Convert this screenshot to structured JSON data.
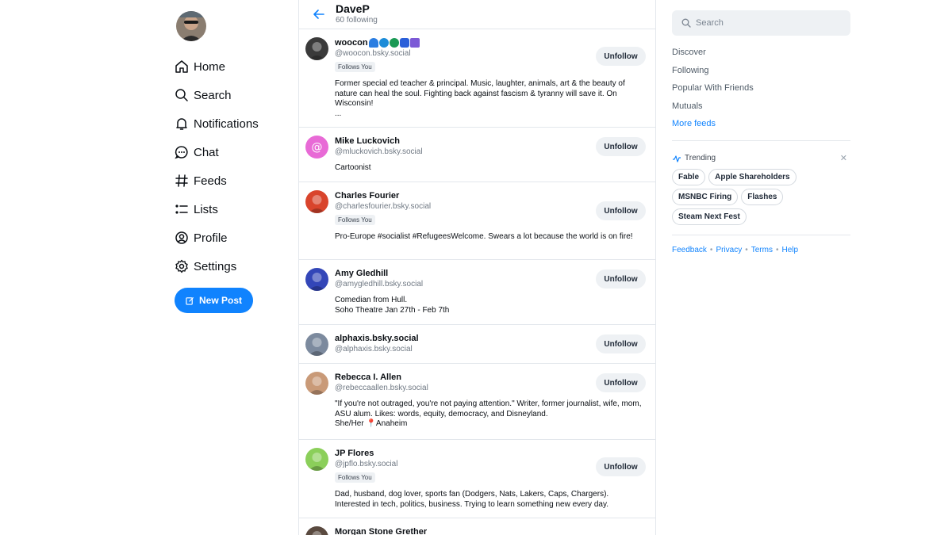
{
  "nav": {
    "items": [
      {
        "label": "Home",
        "icon": "home-icon"
      },
      {
        "label": "Search",
        "icon": "search-icon"
      },
      {
        "label": "Notifications",
        "icon": "bell-icon"
      },
      {
        "label": "Chat",
        "icon": "chat-icon"
      },
      {
        "label": "Feeds",
        "icon": "hash-icon"
      },
      {
        "label": "Lists",
        "icon": "list-icon"
      },
      {
        "label": "Profile",
        "icon": "profile-icon"
      },
      {
        "label": "Settings",
        "icon": "gear-icon"
      }
    ],
    "new_post": "New Post"
  },
  "header": {
    "title": "DaveP",
    "subtitle": "60 following"
  },
  "follow": {
    "unfollow_label": "Unfollow",
    "follows_you_label": "Follows You",
    "rows": [
      {
        "name": "woocon",
        "handle": "@woocon.bsky.social",
        "follows_you": true,
        "bio": "Former special ed teacher & principal.  Music, laughter, animals, art & the beauty of nature can heal the soul. Fighting back against fascism & tyranny will save it. On Wisconsin!\n...",
        "avatar_color": "#3a3a3a"
      },
      {
        "name": "Mike Luckovich",
        "handle": "@mluckovich.bsky.social",
        "follows_you": false,
        "bio": "Cartoonist",
        "avatar_color": "#e86ad6"
      },
      {
        "name": "Charles Fourier",
        "handle": "@charlesfourier.bsky.social",
        "follows_you": true,
        "bio": "Pro-Europe #socialist #RefugeesWelcome. Swears a lot because the world is on fire!",
        "avatar_color": "#d9442c"
      },
      {
        "name": "Amy Gledhill",
        "handle": "@amygledhill.bsky.social",
        "follows_you": false,
        "bio": "Comedian from Hull.\nSoho Theatre Jan 27th - Feb 7th",
        "avatar_color": "#3346b8"
      },
      {
        "name": "alphaxis.bsky.social",
        "handle": "@alphaxis.bsky.social",
        "follows_you": false,
        "bio": "",
        "avatar_color": "#7c8a9e"
      },
      {
        "name": "Rebecca I. Allen",
        "handle": "@rebeccaallen.bsky.social",
        "follows_you": false,
        "bio": "\"If you're not outraged, you're not paying attention.\" Writer, former journalist, wife, mom, ASU alum. Likes: words, equity, democracy, and Disneyland.\nShe/Her 📍Anaheim",
        "avatar_color": "#c99a78"
      },
      {
        "name": "JP Flores",
        "handle": "@jpflo.bsky.social",
        "follows_you": true,
        "bio": "Dad, husband, dog lover, sports fan (Dodgers, Nats, Lakers, Caps, Chargers). Interested in tech, politics, business. Trying to learn something new every day.",
        "avatar_color": "#8bcf5a"
      },
      {
        "name": "Morgan Stone Grether",
        "handle": "",
        "follows_you": false,
        "bio": "",
        "avatar_color": "#5a4a40"
      }
    ]
  },
  "right": {
    "search_placeholder": "Search",
    "feeds": [
      "Discover",
      "Following",
      "Popular With Friends",
      "Mutuals"
    ],
    "more_feeds": "More feeds",
    "trending_title": "Trending",
    "trending_rows": [
      [
        "Fable",
        "Apple Shareholders"
      ],
      [
        "MSNBC Firing",
        "Flashes"
      ],
      [
        "Steam Next Fest"
      ]
    ],
    "footer": [
      "Feedback",
      "Privacy",
      "Terms",
      "Help"
    ]
  },
  "colors": {
    "accent": "#1083fe",
    "border": "#e3e7ec",
    "muted": "#6f7883"
  }
}
